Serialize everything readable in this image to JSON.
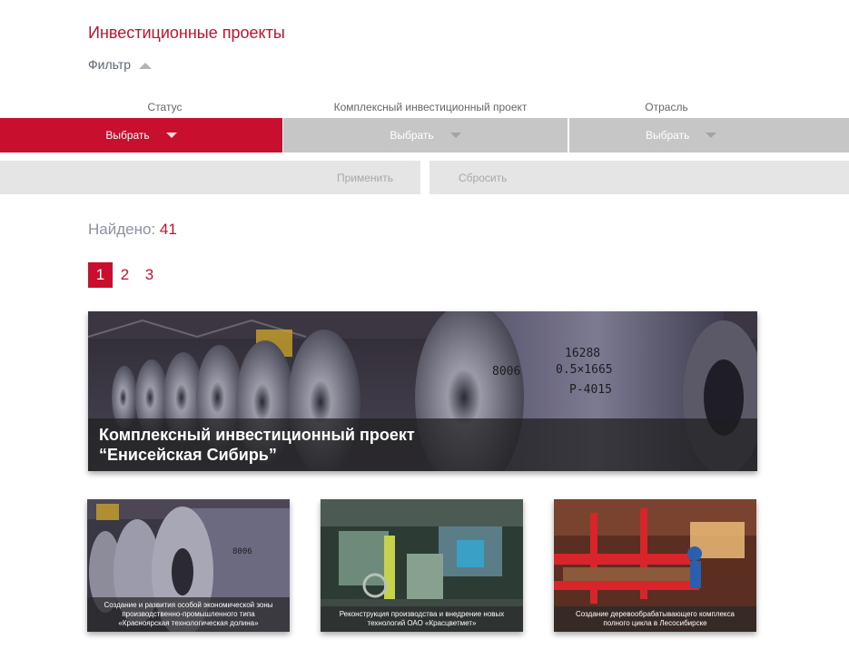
{
  "page": {
    "title": "Инвестиционные проекты"
  },
  "filter": {
    "toggle_label": "Фильтр",
    "fields": [
      {
        "label": "Статус",
        "value": "Выбрать"
      },
      {
        "label": "Комплексный инвестиционный проект",
        "value": "Выбрать"
      },
      {
        "label": "Отрасль",
        "value": "Выбрать"
      }
    ],
    "apply_label": "Применить",
    "reset_label": "Сбросить"
  },
  "results": {
    "found_label": "Найдено:",
    "found_count": "41"
  },
  "pagination": {
    "pages": [
      "1",
      "2",
      "3"
    ],
    "current": "1"
  },
  "featured": {
    "title_line1": "Комплексный инвестиционный проект",
    "title_line2": "“Енисейская Сибирь”"
  },
  "projects": [
    {
      "caption_lines": [
        "Создание и развития особой экономической зоны",
        "производственно-промышленного типа",
        "«Красноярская технологическая долина»"
      ]
    },
    {
      "caption_lines": [
        "Реконструкция производства и внедрение новых",
        "технологий ОАО «Красцветмет»"
      ]
    },
    {
      "caption_lines": [
        "Создание деревообрабатывающего комплекса",
        "полного цикла в Лесосибирске"
      ]
    }
  ],
  "colors": {
    "accent": "#c8102e",
    "select_inactive": "#c6c6c6",
    "button_bg": "#e5e5e5"
  }
}
